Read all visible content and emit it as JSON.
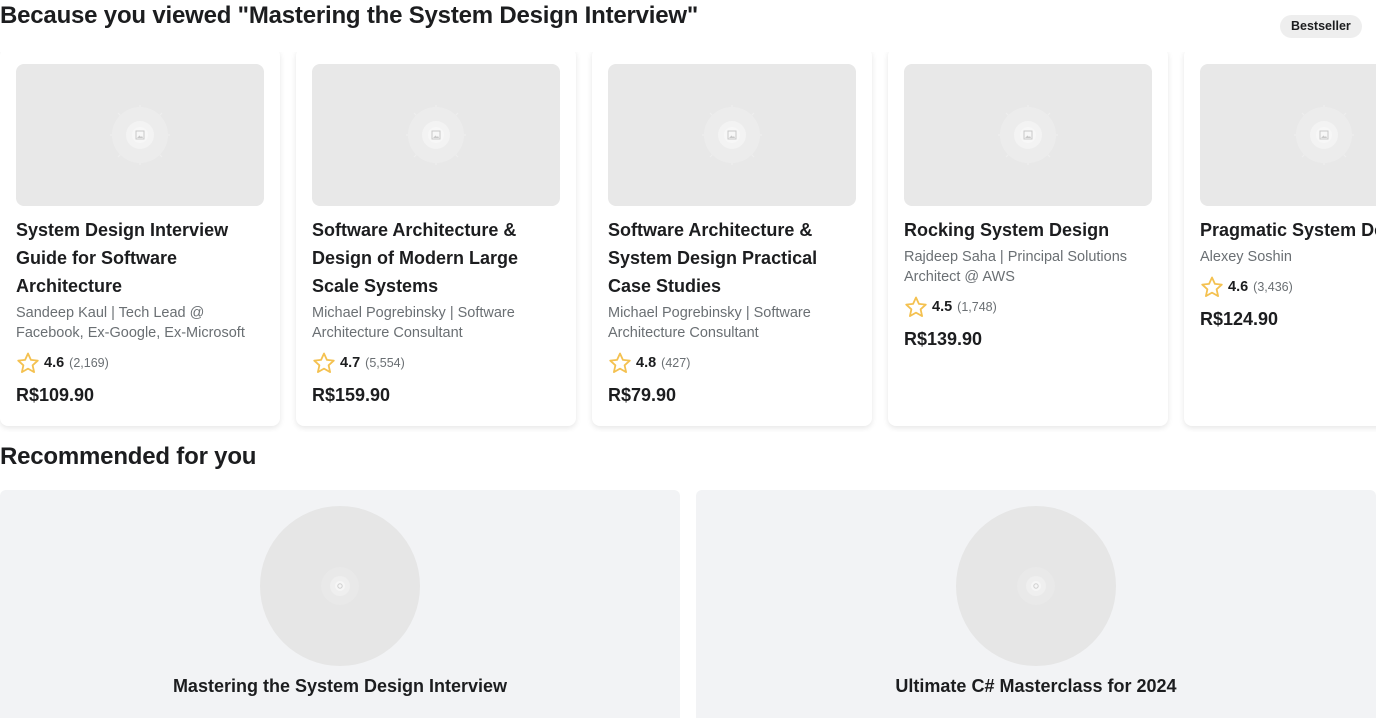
{
  "sections": {
    "viewed_title": "Because you viewed \"Mastering the System Design Interview\"",
    "recommended_title": "Recommended for you",
    "badge": "Bestseller"
  },
  "courses": [
    {
      "title": "System Design Interview Guide for Software Architecture",
      "author": "Sandeep Kaul | Tech Lead @ Facebook, Ex-Google, Ex-Microsoft",
      "rating": "4.6",
      "reviews": "(2,169)",
      "price": "R$109.90"
    },
    {
      "title": "Software Architecture & Design of Modern Large Scale Systems",
      "author": "Michael Pogrebinsky | Software Architecture Consultant",
      "rating": "4.7",
      "reviews": "(5,554)",
      "price": "R$159.90"
    },
    {
      "title": "Software Architecture & System Design Practical Case Studies",
      "author": "Michael Pogrebinsky | Software Architecture Consultant",
      "rating": "4.8",
      "reviews": "(427)",
      "price": "R$79.90"
    },
    {
      "title": "Rocking System Design",
      "author": "Rajdeep Saha | Principal Solutions Architect @ AWS",
      "rating": "4.5",
      "reviews": "(1,748)",
      "price": "R$139.90"
    },
    {
      "title": "Pragmatic System Design",
      "author": "Alexey Soshin",
      "rating": "4.6",
      "reviews": "(3,436)",
      "price": "R$124.90"
    }
  ],
  "recommended": [
    {
      "title": "Mastering the System Design Interview"
    },
    {
      "title": "Ultimate C# Masterclass for 2024"
    }
  ],
  "icons": {
    "rating_star": "star-outline-icon",
    "thumbnail_placeholder": "image-placeholder-icon"
  },
  "colors": {
    "star": "#f4c150",
    "text_primary": "#1c1d1f",
    "text_secondary": "#6a6f73",
    "placeholder": "#e8e8e8"
  }
}
